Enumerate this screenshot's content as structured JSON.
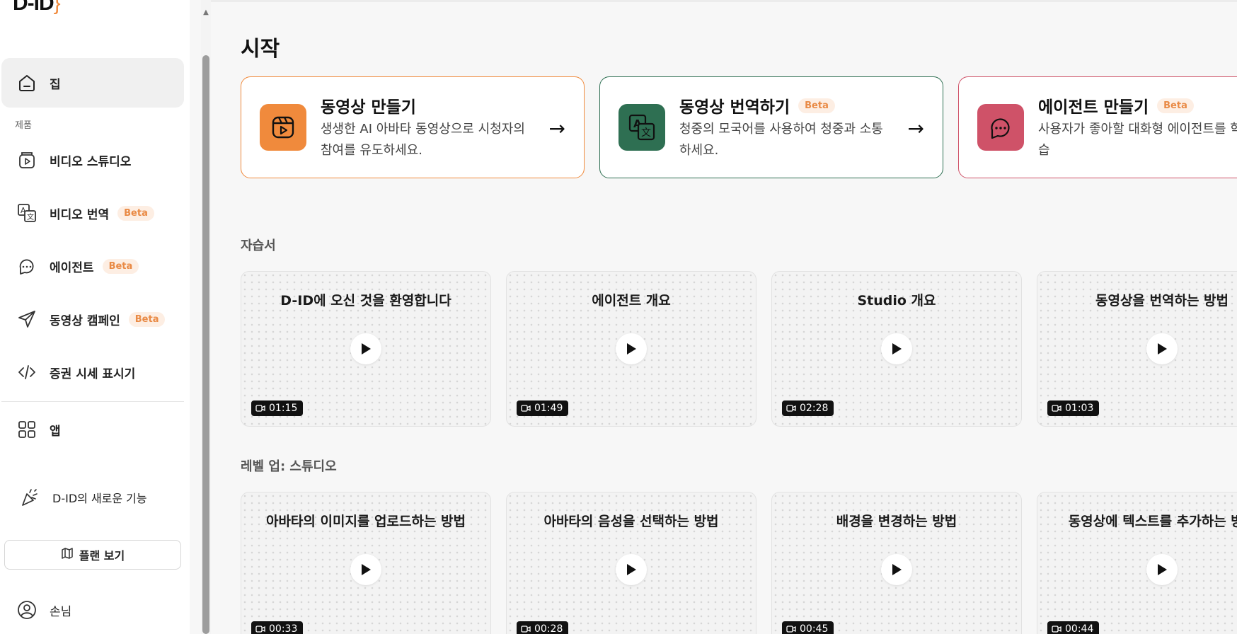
{
  "sidebar": {
    "logo": "D-ID",
    "home_label": "집",
    "section_products": "제품",
    "items": [
      {
        "label": "비디오 스튜디오",
        "beta": ""
      },
      {
        "label": "비디오 번역",
        "beta": "Beta"
      },
      {
        "label": "에이전트",
        "beta": "Beta"
      },
      {
        "label": "동영상 캠페인",
        "beta": "Beta"
      },
      {
        "label": "증권 시세 표시기",
        "beta": ""
      }
    ],
    "apps_label": "앱",
    "whats_new_label": "D-ID의 새로운 기능",
    "plan_button": "플랜 보기",
    "user_label": "손님"
  },
  "main": {
    "title": "시작",
    "actions": [
      {
        "title": "동영상 만들기",
        "beta": "",
        "desc": "생생한 AI 아바타 동영상으로 시청자의 참여를 유도하세요.",
        "color": "#f08a3c"
      },
      {
        "title": "동영상 번역하기",
        "beta": "Beta",
        "desc": "청중의 모국어를 사용하여 청중과 소통하세요.",
        "color": "#2e6f52"
      },
      {
        "title": "에이전트 만들기",
        "beta": "Beta",
        "desc": "사용자가 좋아할 대화형 에이전트를 학습",
        "color": "#cf5268"
      }
    ],
    "tutorials_heading": "자습서",
    "tutorials": [
      {
        "title": "D-ID에 오신 것을 환영합니다",
        "duration": "01:15"
      },
      {
        "title": "에이전트 개요",
        "duration": "01:49"
      },
      {
        "title": "Studio 개요",
        "duration": "02:28"
      },
      {
        "title": "동영상을 번역하는 방법",
        "duration": "01:03"
      }
    ],
    "levelup_heading": "레벨 업: 스튜디오",
    "levelup": [
      {
        "title": "아바타의 이미지를 업로드하는 방법",
        "duration": "00:33"
      },
      {
        "title": "아바타의 음성을 선택하는 방법",
        "duration": "00:28"
      },
      {
        "title": "배경을 변경하는 방법",
        "duration": "00:45"
      },
      {
        "title": "동영상에 텍스트를 추가하는 방법",
        "duration": "00:44"
      }
    ]
  }
}
